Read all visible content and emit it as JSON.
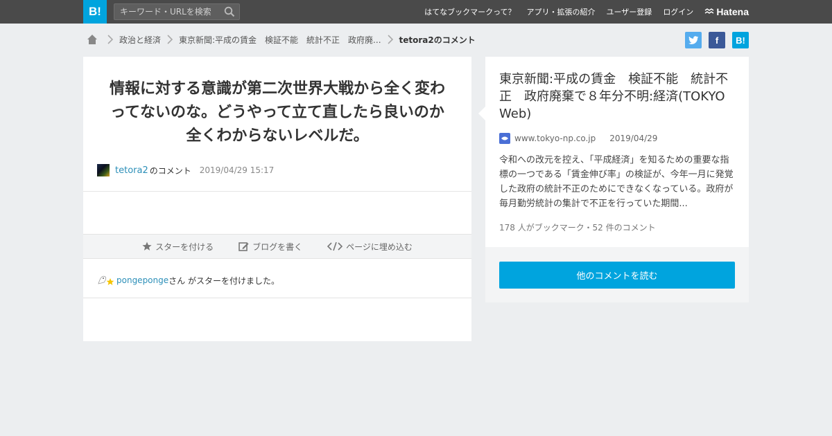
{
  "header": {
    "logo_text": "B!",
    "search_placeholder": "キーワード・URLを検索",
    "nav": [
      "はてなブックマークって？",
      "アプリ・拡張の紹介",
      "ユーザー登録",
      "ログイン"
    ],
    "brand": "Hatena"
  },
  "breadcrumb": {
    "items": [
      "政治と経済",
      "東京新聞:平成の賃金　検証不能　統計不正　政府廃..."
    ],
    "current": "tetora2のコメント"
  },
  "share": {
    "facebook": "f",
    "hatena": "B!"
  },
  "comment": {
    "text": "情報に対する意識が第二次世界大戦から全く変わってないのな。どうやって立て直したら良いのか全くわからないレベルだ。",
    "user": "tetora2",
    "user_suffix": "のコメント",
    "datetime": "2019/04/29 15:17"
  },
  "actions": {
    "star": "スターを付ける",
    "blog": "ブログを書く",
    "embed": "ページに埋め込む"
  },
  "stars": {
    "user": "pongeponge",
    "text": "さん がスターを付けました。"
  },
  "article": {
    "title": "東京新聞:平成の賃金　検証不能　統計不正　政府廃棄で８年分不明:経済(TOKYO Web)",
    "domain": "www.tokyo-np.co.jp",
    "date": "2019/04/29",
    "summary": "令和への改元を控え、「平成経済」を知るための重要な指標の一つである「賃金伸び率」の検証が、今年一月に発覚した政府の統計不正のためにできなくなっている。政府が毎月勤労統計の集計で不正を行っていた期間...",
    "bookmarks": "178 人がブックマーク・52 件のコメント",
    "read_button": "他のコメントを読む"
  },
  "colors": {
    "topbar": "#4a4a4a",
    "accent": "#00a4de",
    "link": "#2c8fb8",
    "twitter": "#55acee",
    "facebook": "#3b5998"
  }
}
